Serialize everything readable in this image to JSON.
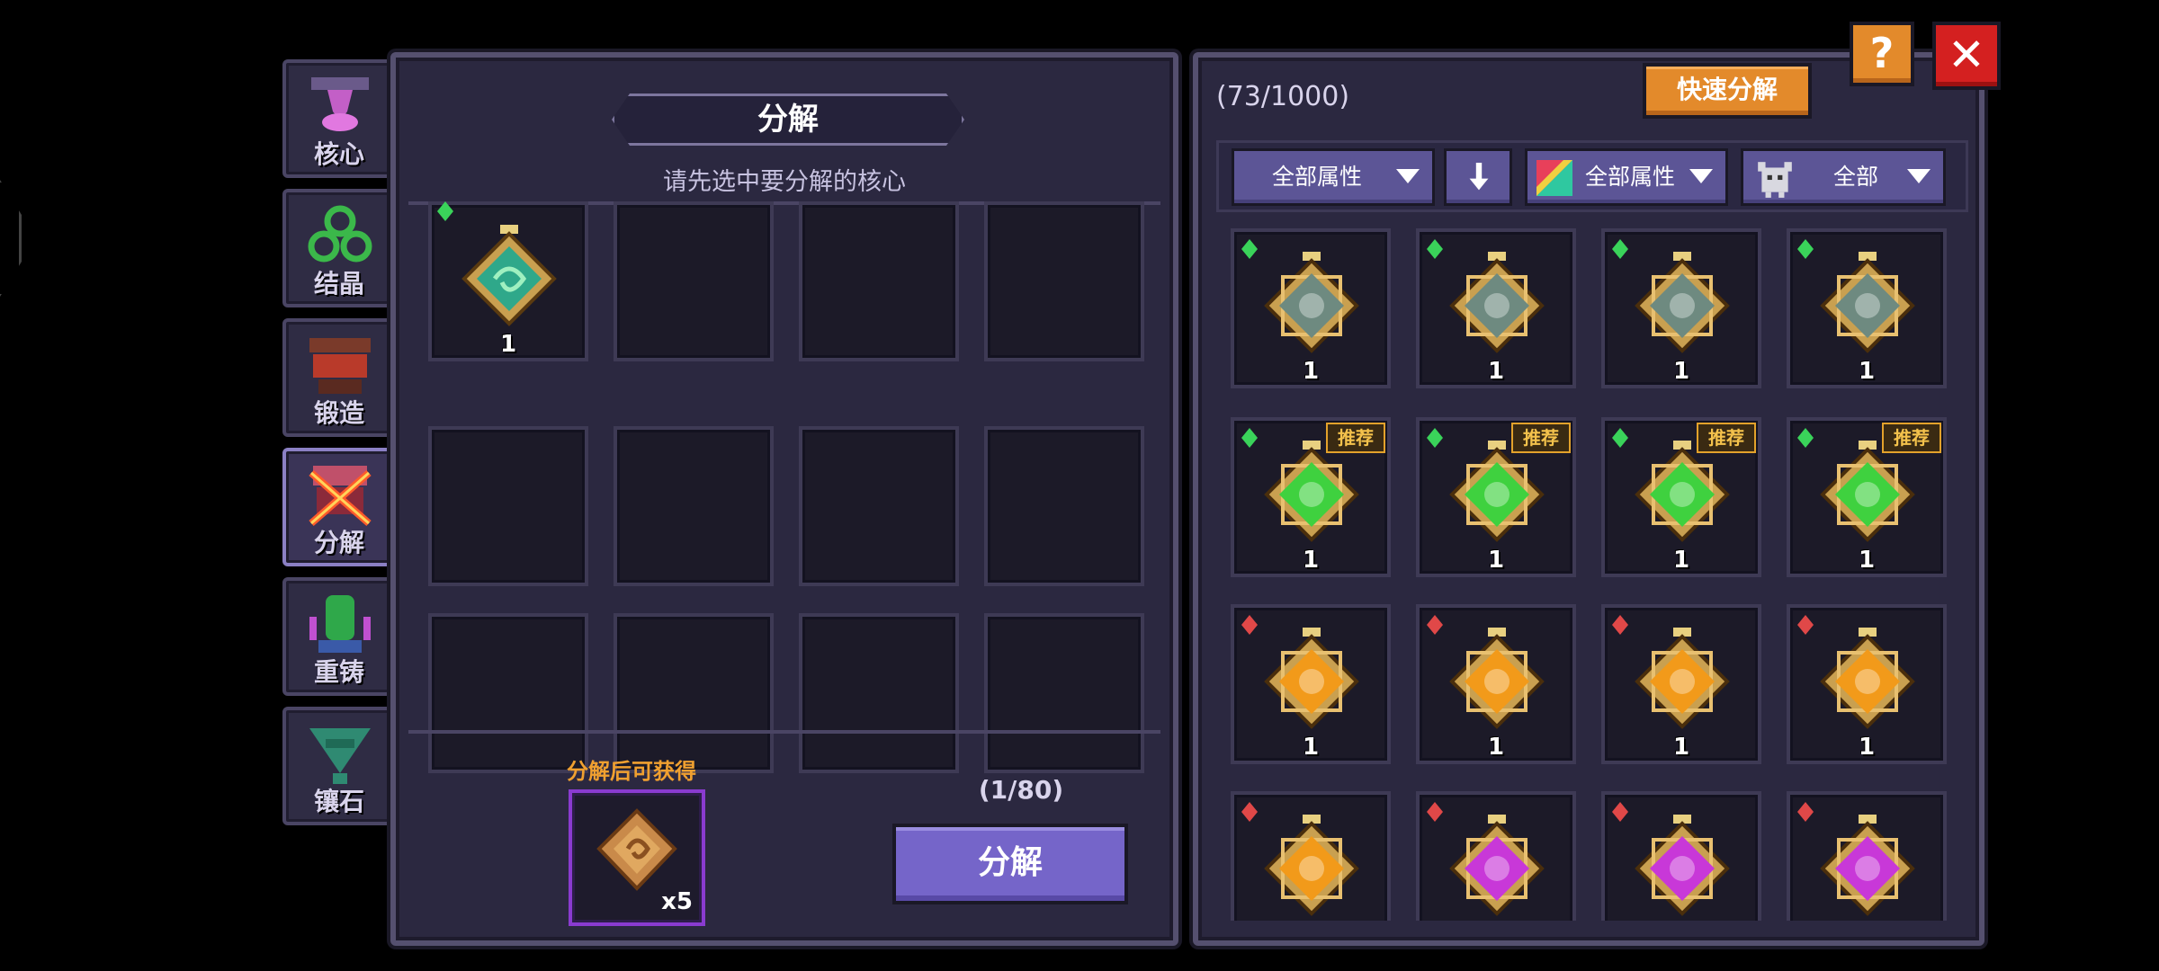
{
  "sidebar": {
    "tabs": [
      {
        "label": "核心",
        "icon": "core-icon"
      },
      {
        "label": "结晶",
        "icon": "crystal-icon"
      },
      {
        "label": "锻造",
        "icon": "forge-icon"
      },
      {
        "label": "分解",
        "icon": "decompose-icon",
        "active": true
      },
      {
        "label": "重铸",
        "icon": "recast-icon"
      },
      {
        "label": "镶石",
        "icon": "inlay-icon"
      }
    ]
  },
  "decompose": {
    "title": "分解",
    "subtitle": "请先选中要分解的核心",
    "selected_level": "1",
    "reward_label": "分解后可获得",
    "reward_count": "x5",
    "capacity": "(1/80)",
    "button_label": "分解"
  },
  "inventory": {
    "count": "(73/1000)",
    "quick_button": "快速分解",
    "filters": {
      "attribute": "全部属性",
      "element": "全部属性",
      "type": "全部"
    },
    "recommend_label": "推荐",
    "items": [
      {
        "level": "1",
        "gem": "green",
        "color": "gray",
        "rec": false
      },
      {
        "level": "1",
        "gem": "green",
        "color": "gray",
        "rec": false
      },
      {
        "level": "1",
        "gem": "green",
        "color": "gray",
        "rec": false
      },
      {
        "level": "1",
        "gem": "green",
        "color": "gray",
        "rec": false
      },
      {
        "level": "1",
        "gem": "green",
        "color": "green",
        "rec": true
      },
      {
        "level": "1",
        "gem": "green",
        "color": "green",
        "rec": true
      },
      {
        "level": "1",
        "gem": "green",
        "color": "green",
        "rec": true
      },
      {
        "level": "1",
        "gem": "green",
        "color": "green",
        "rec": true
      },
      {
        "level": "1",
        "gem": "red",
        "color": "orange",
        "rec": false
      },
      {
        "level": "1",
        "gem": "red",
        "color": "orange",
        "rec": false
      },
      {
        "level": "1",
        "gem": "red",
        "color": "orange",
        "rec": false
      },
      {
        "level": "1",
        "gem": "red",
        "color": "orange",
        "rec": false
      },
      {
        "level": "",
        "gem": "red",
        "color": "orange",
        "rec": false
      },
      {
        "level": "",
        "gem": "red",
        "color": "purple",
        "rec": false
      },
      {
        "level": "",
        "gem": "red",
        "color": "purple",
        "rec": false
      },
      {
        "level": "",
        "gem": "red",
        "color": "purple",
        "rec": false
      }
    ]
  },
  "colors": {
    "gray": "#6e8a80",
    "green": "#3fd13f",
    "orange": "#f29a1a",
    "purple": "#c838d8",
    "teal": "#2fa88a",
    "gold": "#c9a050",
    "gem_green": "#3ad35a",
    "gem_red": "#e04848"
  }
}
